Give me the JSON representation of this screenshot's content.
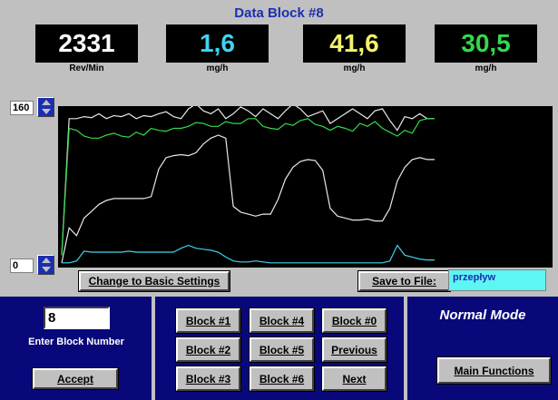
{
  "header": {
    "title": "Data Block #8"
  },
  "readouts": [
    {
      "value": "2331",
      "unit": "Rev/Min",
      "color": "#ffffff"
    },
    {
      "value": "1,6",
      "unit": "mg/h",
      "color": "#3fd3f0"
    },
    {
      "value": "41,6",
      "unit": "mg/h",
      "color": "#f2f26a"
    },
    {
      "value": "30,5",
      "unit": "mg/h",
      "color": "#33d94a"
    }
  ],
  "chart": {
    "ymax_value": "160",
    "ymin_value": "0"
  },
  "chart_data": {
    "type": "line",
    "ylim": [
      0,
      160
    ],
    "x": [
      0,
      1,
      2,
      3,
      4,
      5,
      6,
      7,
      8,
      9,
      10,
      11,
      12,
      13,
      14,
      15,
      16,
      17,
      18,
      19,
      20,
      21,
      22,
      23,
      24,
      25,
      26,
      27,
      28,
      29,
      30,
      31,
      32,
      33,
      34,
      35,
      36,
      37,
      38,
      39,
      40,
      41,
      42,
      43,
      44,
      45,
      46,
      47,
      48,
      49,
      50
    ],
    "series": [
      {
        "color": "#e8e8e8",
        "values": [
          10,
          150,
          150,
          152,
          151,
          155,
          150,
          153,
          152,
          155,
          150,
          153,
          152,
          155,
          157,
          152,
          150,
          160,
          165,
          158,
          155,
          160,
          150,
          155,
          162,
          158,
          152,
          160,
          155,
          150,
          158,
          165,
          160,
          152,
          155,
          158,
          145,
          150,
          155,
          160,
          155,
          150,
          158,
          160,
          148,
          138,
          152,
          150,
          155,
          150,
          150
        ]
      },
      {
        "color": "#33d94a",
        "values": [
          10,
          140,
          138,
          132,
          130,
          130,
          133,
          135,
          132,
          131,
          136,
          133,
          140,
          138,
          137,
          140,
          140,
          142,
          146,
          145,
          142,
          142,
          147,
          145,
          145,
          150,
          150,
          142,
          140,
          139,
          145,
          143,
          148,
          150,
          144,
          142,
          138,
          142,
          140,
          137,
          145,
          142,
          147,
          140,
          136,
          132,
          138,
          135,
          148,
          150,
          150
        ]
      },
      {
        "color": "#e8e8e8",
        "values": [
          2,
          38,
          30,
          48,
          55,
          62,
          66,
          68,
          68,
          68,
          68,
          68,
          70,
          98,
          110,
          112,
          113,
          112,
          115,
          124,
          130,
          133,
          130,
          60,
          54,
          52,
          50,
          52,
          52,
          67,
          88,
          100,
          106,
          108,
          107,
          97,
          58,
          50,
          48,
          46,
          46,
          47,
          45,
          45,
          58,
          86,
          100,
          108,
          110,
          108,
          108
        ]
      },
      {
        "color": "#3fd3f0",
        "values": [
          2,
          2,
          4,
          14,
          13,
          13,
          13,
          13,
          13,
          14,
          13,
          13,
          13,
          13,
          13,
          13,
          17,
          20,
          17,
          16,
          15,
          13,
          8,
          4,
          3,
          3,
          4,
          3,
          2,
          2,
          2,
          2,
          2,
          2,
          2,
          2,
          2,
          2,
          2,
          2,
          2,
          2,
          2,
          2,
          4,
          20,
          10,
          8,
          6,
          5,
          5
        ]
      }
    ]
  },
  "controls": {
    "basic_settings_label": "Change to Basic Settings",
    "save_label": "Save to File:",
    "save_filename": "przepływ"
  },
  "bottom": {
    "block_number": "8",
    "enter_block_label": "Enter Block Number",
    "accept_label": "Accept",
    "blocks": [
      "Block #1",
      "Block #2",
      "Block #3",
      "Block #4",
      "Block #5",
      "Block #6",
      "Block #0",
      "Previous",
      "Next"
    ],
    "mode_label": "Normal Mode",
    "main_functions_label": "Main Functions"
  }
}
